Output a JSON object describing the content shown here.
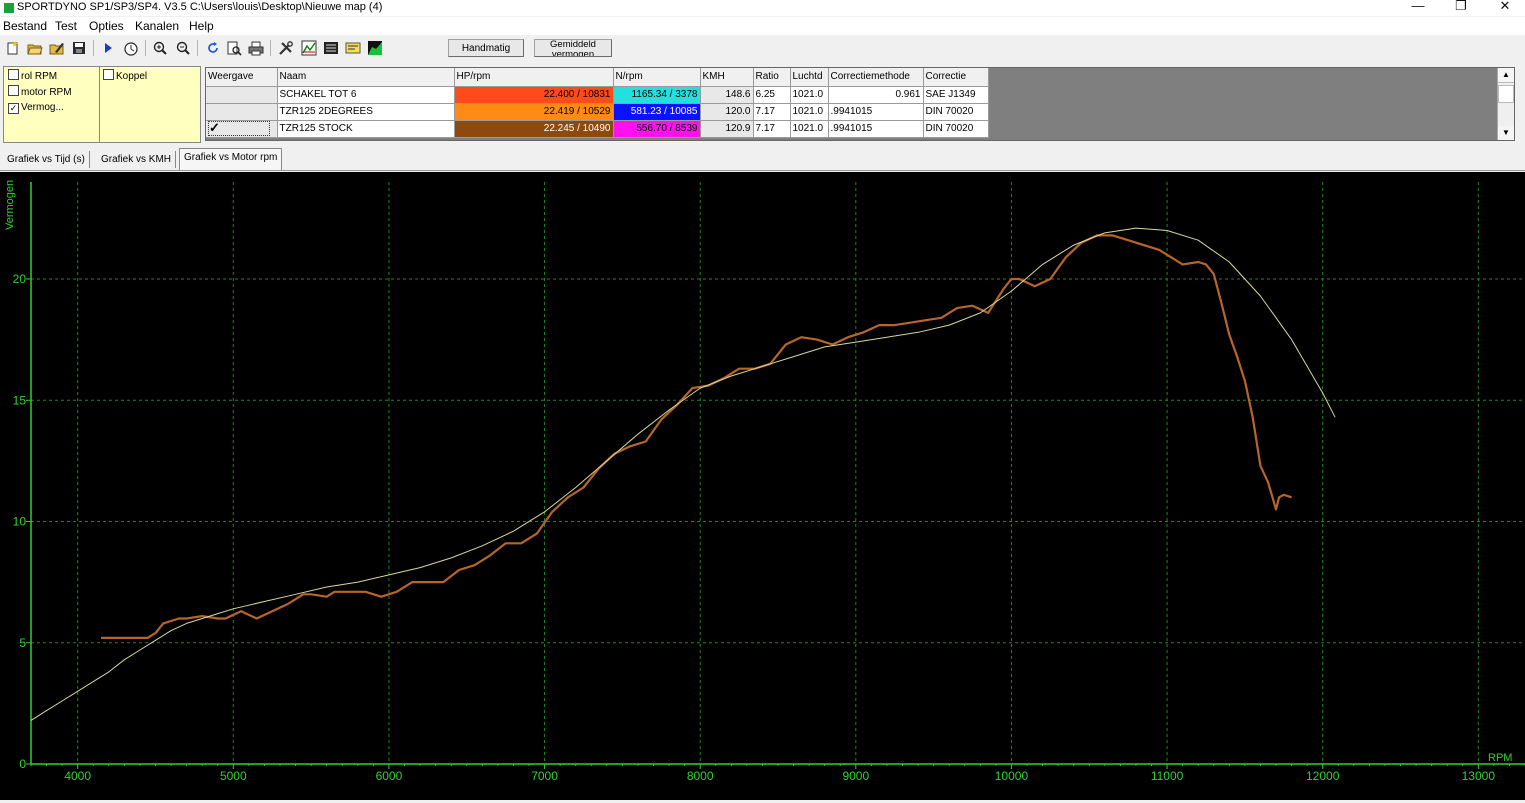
{
  "window": {
    "title": "SPORTDYNO SP1/SP3/SP4. V3.5  C:\\Users\\louis\\Desktop\\Nieuwe map (4)",
    "minimize": "—",
    "restore": "❐",
    "close": "✕"
  },
  "menu": [
    "Bestand",
    "Test",
    "Opties",
    "Kanalen",
    "Help"
  ],
  "toolbar": {
    "icons": [
      "new-file-icon",
      "open-folder-icon",
      "edit-folder-icon",
      "save-icon",
      "play-icon",
      "stopwatch-icon",
      "zoom-in-icon",
      "zoom-out-icon",
      "refresh-icon",
      "print-preview-icon",
      "print-icon",
      "tools-icon",
      "graph-icon",
      "list-icon",
      "notes-icon",
      "chart-area-icon"
    ],
    "handmatig": "Handmatig",
    "gemiddeld": "Gemiddeld vermogen"
  },
  "channels": {
    "col1": [
      {
        "label": "rol RPM",
        "checked": false
      },
      {
        "label": "motor RPM",
        "checked": false
      },
      {
        "label": "Vermog...",
        "checked": true
      }
    ],
    "col2": [
      {
        "label": "Koppel",
        "checked": false
      }
    ]
  },
  "grid": {
    "headers": [
      "Weergave",
      "Naam",
      "HP/rpm",
      "N/rpm",
      "KMH",
      "Ratio",
      "Luchtd",
      "Correctiemethode",
      "Correctie"
    ],
    "rows": [
      {
        "visible": false,
        "naam": "SCHAKEL TOT 6",
        "hp": "22.400 / 10831",
        "hp_color": "#ff4a1a",
        "n": "1165.34 / 3378",
        "n_color": "#22e0e0",
        "kmh": "148.6",
        "ratio": "6.25",
        "luchtd": "1021.0",
        "corrmeth": "0.961",
        "corr": "SAE J1349"
      },
      {
        "visible": false,
        "naam": "TZR125 2DEGREES",
        "hp": "22.419 / 10529",
        "hp_color": "#ff8a14",
        "n": "581.23 / 10085",
        "n_color": "#0a12ff",
        "kmh": "120.0",
        "ratio": "7.17",
        "luchtd": "1021.0",
        "corrmeth": ".9941015",
        "corr": "DIN 70020"
      },
      {
        "visible": true,
        "naam": "TZR125 STOCK",
        "hp": "22.245 / 10490",
        "hp_color": "#8c4a0e",
        "n": "556.70 / 8539",
        "n_color": "#ff10f0",
        "kmh": "120.9",
        "ratio": "7.17",
        "luchtd": "1021.0",
        "corrmeth": ".9941015",
        "corr": "DIN 70020"
      }
    ],
    "scroll_up": "▲",
    "scroll_down": "▼"
  },
  "tabs": [
    "Grafiek vs Tijd (s)",
    "Grafiek vs KMH",
    "Grafiek vs Motor rpm"
  ],
  "chart_data": {
    "type": "line",
    "ylabel": "Vermogen",
    "xlabel": "RPM",
    "xlim": [
      3700,
      13300
    ],
    "ylim": [
      0,
      24.0
    ],
    "xticks": [
      4000,
      5000,
      6000,
      7000,
      8000,
      9000,
      10000,
      11000,
      12000,
      13000
    ],
    "yticks": [
      0,
      5,
      10,
      15,
      20
    ],
    "grid": true,
    "colors": {
      "measured": "#b8652a",
      "fit": "#d8d89a",
      "grid": "#1c8a1c",
      "axis": "#2fd22f"
    },
    "series": [
      {
        "role": "measured",
        "x": [
          4150,
          4250,
          4350,
          4450,
          4500,
          4550,
          4650,
          4700,
          4800,
          4900,
          4950,
          5050,
          5150,
          5250,
          5350,
          5450,
          5500,
          5600,
          5650,
          5750,
          5850,
          5950,
          6050,
          6150,
          6250,
          6350,
          6450,
          6550,
          6650,
          6750,
          6850,
          6950,
          7050,
          7150,
          7250,
          7350,
          7450,
          7550,
          7650,
          7750,
          7850,
          7950,
          8050,
          8150,
          8250,
          8350,
          8450,
          8550,
          8650,
          8750,
          8850,
          8950,
          9050,
          9150,
          9250,
          9350,
          9450,
          9550,
          9650,
          9750,
          9850,
          9950,
          10000,
          10050,
          10150,
          10250,
          10350,
          10450,
          10550,
          10650,
          10750,
          10850,
          10950,
          11050,
          11100,
          11200,
          11250,
          11300,
          11350,
          11400,
          11450,
          11500,
          11550,
          11600,
          11650,
          11700,
          11720,
          11750,
          11800
        ],
        "y": [
          5.2,
          5.2,
          5.2,
          5.2,
          5.4,
          5.8,
          6.0,
          6.0,
          6.1,
          6.0,
          6.0,
          6.3,
          6.0,
          6.3,
          6.6,
          7.0,
          7.0,
          6.9,
          7.1,
          7.1,
          7.1,
          6.9,
          7.1,
          7.5,
          7.5,
          7.5,
          8.0,
          8.2,
          8.6,
          9.1,
          9.1,
          9.5,
          10.4,
          11.0,
          11.4,
          12.2,
          12.8,
          13.1,
          13.3,
          14.2,
          14.8,
          15.5,
          15.6,
          15.9,
          16.3,
          16.3,
          16.5,
          17.3,
          17.6,
          17.5,
          17.3,
          17.6,
          17.8,
          18.1,
          18.1,
          18.2,
          18.3,
          18.4,
          18.8,
          18.9,
          18.6,
          19.6,
          20.0,
          20.0,
          19.7,
          20.0,
          20.9,
          21.5,
          21.8,
          21.8,
          21.6,
          21.4,
          21.2,
          20.8,
          20.6,
          20.7,
          20.6,
          20.2,
          19.0,
          17.7,
          16.8,
          15.8,
          14.3,
          12.3,
          11.6,
          10.5,
          11.0,
          11.1,
          11.0
        ]
      },
      {
        "role": "fit",
        "x": [
          3700,
          3800,
          3900,
          4000,
          4100,
          4200,
          4300,
          4400,
          4500,
          4600,
          4700,
          4800,
          4900,
          5000,
          5200,
          5400,
          5600,
          5800,
          6000,
          6200,
          6400,
          6600,
          6800,
          7000,
          7200,
          7400,
          7600,
          7800,
          8000,
          8200,
          8400,
          8600,
          8800,
          9000,
          9200,
          9400,
          9600,
          9800,
          10000,
          10200,
          10400,
          10600,
          10800,
          11000,
          11200,
          11400,
          11600,
          11800,
          12000,
          12080
        ],
        "y": [
          1.8,
          2.2,
          2.6,
          3.0,
          3.4,
          3.8,
          4.3,
          4.7,
          5.1,
          5.5,
          5.8,
          6.0,
          6.2,
          6.4,
          6.7,
          7.0,
          7.3,
          7.5,
          7.8,
          8.1,
          8.5,
          9.0,
          9.6,
          10.4,
          11.4,
          12.5,
          13.6,
          14.6,
          15.5,
          16.0,
          16.4,
          16.8,
          17.2,
          17.4,
          17.6,
          17.8,
          18.1,
          18.6,
          19.5,
          20.6,
          21.4,
          21.9,
          22.1,
          22.0,
          21.6,
          20.7,
          19.3,
          17.5,
          15.3,
          14.3
        ]
      }
    ]
  }
}
